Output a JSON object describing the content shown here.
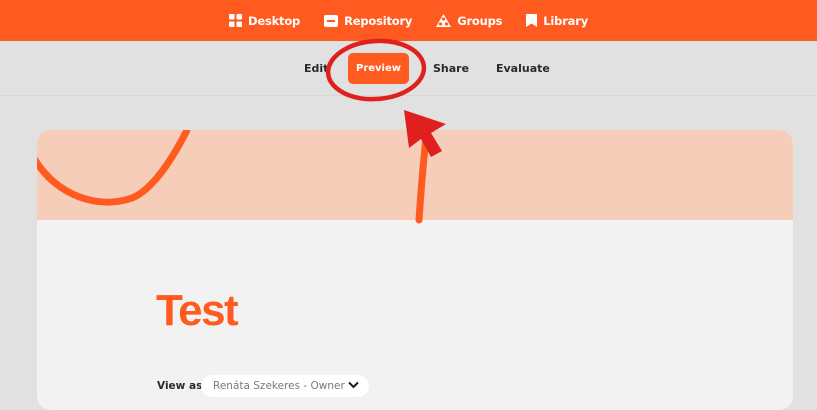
{
  "topnav": {
    "items": [
      {
        "label": "Desktop",
        "icon": "grid-icon"
      },
      {
        "label": "Repository",
        "icon": "folder-icon"
      },
      {
        "label": "Groups",
        "icon": "groups-icon"
      },
      {
        "label": "Library",
        "icon": "bookmark-icon"
      }
    ]
  },
  "tabs": {
    "edit": "Edit",
    "preview": "Preview",
    "share": "Share",
    "evaluate": "Evaluate"
  },
  "content": {
    "title": "Test",
    "view_as_label": "View as:",
    "view_as_value": "Renáta Szekeres - Owner"
  },
  "colors": {
    "accent": "#ff5a1f",
    "banner": "#f5cdb9",
    "annotation": "#e0201e"
  }
}
